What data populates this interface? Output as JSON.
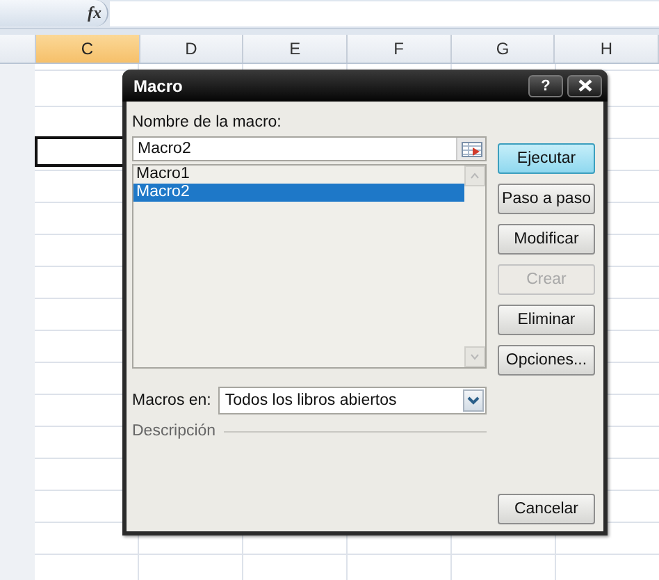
{
  "formula_bar": {
    "function_label": "fx"
  },
  "columns": [
    {
      "label": "C",
      "selected": true
    },
    {
      "label": "D",
      "selected": false
    },
    {
      "label": "E",
      "selected": false
    },
    {
      "label": "F",
      "selected": false
    },
    {
      "label": "G",
      "selected": false
    },
    {
      "label": "H",
      "selected": false
    }
  ],
  "dialog": {
    "title": "Macro",
    "help_button": "?",
    "name_label": "Nombre de la macro:",
    "name_value": "Macro2",
    "macros": [
      {
        "name": "Macro1",
        "selected": false
      },
      {
        "name": "Macro2",
        "selected": true
      }
    ],
    "buttons": [
      {
        "label": "Ejecutar",
        "default": true,
        "disabled": false
      },
      {
        "label": "Paso a paso",
        "default": false,
        "disabled": false
      },
      {
        "label": "Modificar",
        "default": false,
        "disabled": false
      },
      {
        "label": "Crear",
        "default": false,
        "disabled": true
      },
      {
        "label": "Eliminar",
        "default": false,
        "disabled": false
      },
      {
        "label": "Opciones...",
        "default": false,
        "disabled": false
      }
    ],
    "macros_in_label": "Macros en:",
    "macros_in_value": "Todos los libros abiertos",
    "description_label": "Descripción",
    "cancel_button": "Cancelar"
  }
}
